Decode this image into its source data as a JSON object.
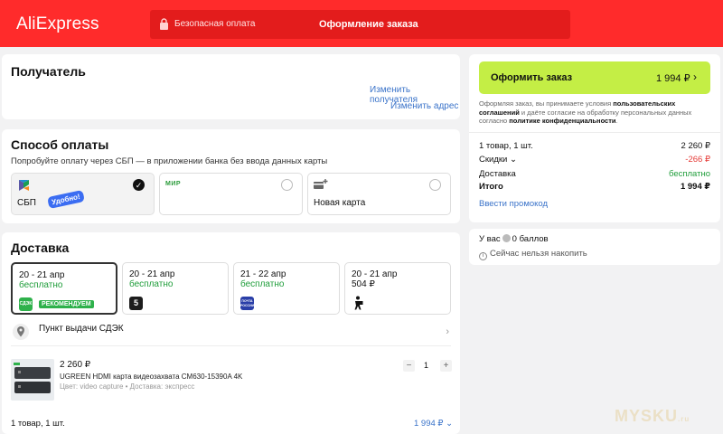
{
  "header": {
    "logo": "AliExpress",
    "secure_payment": "Безопасная оплата",
    "title": "Оформление заказа",
    "accent_color": "#ff2b2b"
  },
  "recipient": {
    "title": "Получатель",
    "change_recipient": "Изменить получателя",
    "change_address": "Изменить адрес"
  },
  "payment": {
    "title": "Способ оплаты",
    "hint": "Попробуйте оплату через СБП — в приложении банка без ввода данных карты",
    "options": [
      {
        "label": "СБП",
        "badge": "Удобно!",
        "selected": true,
        "icon": "sbp-logo-icon"
      },
      {
        "label": "",
        "logo_text": "МИР",
        "selected": false,
        "icon": "mir-logo-icon"
      },
      {
        "label": "Новая карта",
        "selected": false,
        "icon": "card-plus-icon"
      }
    ]
  },
  "delivery": {
    "title": "Доставка",
    "options": [
      {
        "date": "20 - 21 апр",
        "price": "бесплатно",
        "carrier": "СДЭК",
        "badge": "РЕКОМЕНДУЕМ",
        "selected": true
      },
      {
        "date": "20 - 21 апр",
        "price": "бесплатно",
        "carrier": "5",
        "selected": false
      },
      {
        "date": "21 - 22 апр",
        "price": "бесплатно",
        "carrier": "ПОЧТА РОССИИ",
        "selected": false
      },
      {
        "date": "20 - 21 апр",
        "price": "504 ₽",
        "carrier": "courier",
        "selected": false
      }
    ],
    "pickup_point": "Пункт выдачи СДЭК",
    "product": {
      "price": "2 260 ₽",
      "name": "UGREEN HDMI карта видеозахвата CM630-15390A 4K",
      "variant": "Цвет: video capture • Доставка: экспресс",
      "quantity": "1",
      "minus": "−",
      "plus": "+"
    },
    "footer_count": "1 товар, 1 шт.",
    "footer_total": "1 994 ₽"
  },
  "summary": {
    "order_button": "Оформить заказ",
    "order_amount": "1 994 ₽",
    "legal_1": "Оформляя заказ, вы принимаете условия",
    "legal_link_1": "пользовательских соглашений",
    "legal_2": "и даёте согласие на обработку персональных данных согласно",
    "legal_link_2": "политике конфиденциальности",
    "rows": [
      {
        "label": "1 товар, 1 шт.",
        "value": "2 260 ₽",
        "tone": ""
      },
      {
        "label": "Скидки",
        "value": "-266 ₽",
        "tone": "red"
      },
      {
        "label": "Доставка",
        "value": "бесплатно",
        "tone": "green"
      },
      {
        "label": "Итого",
        "value": "1 994 ₽",
        "tone": "bold"
      }
    ],
    "promo": "Ввести промокод",
    "button_color": "#c4ee45"
  },
  "bonus": {
    "have": "У вас",
    "points": "0 баллов",
    "cannot": "Сейчас нельзя накопить"
  },
  "watermark": {
    "text": "MYSKU",
    "suffix": ".ru"
  }
}
